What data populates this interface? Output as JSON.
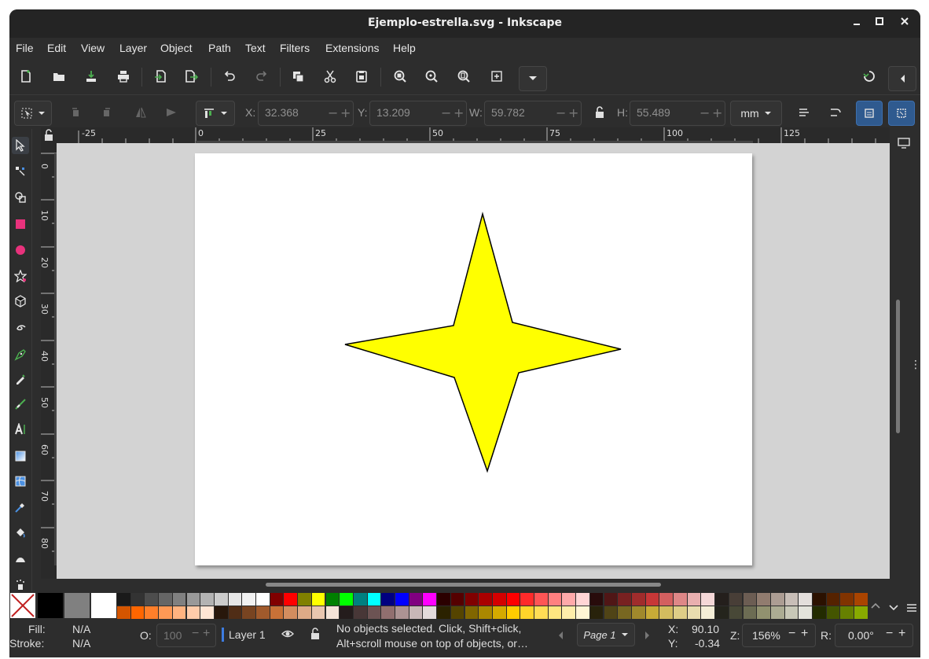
{
  "window": {
    "title": "Ejemplo-estrella.svg - Inkscape"
  },
  "menu": [
    "File",
    "Edit",
    "View",
    "Layer",
    "Object",
    "Path",
    "Text",
    "Filters",
    "Extensions",
    "Help"
  ],
  "toolbar": {
    "x_label": "X:",
    "x_value": "32.368",
    "y_label": "Y:",
    "y_value": "13.209",
    "w_label": "W:",
    "w_value": "59.782",
    "h_label": "H:",
    "h_value": "55.489",
    "unit": "mm"
  },
  "ruler": {
    "h_labels": [
      "-25",
      "0",
      "25",
      "50",
      "75",
      "100",
      "125"
    ],
    "v_labels": [
      "0",
      "10",
      "20",
      "30",
      "40",
      "50",
      "60",
      "70",
      "80"
    ]
  },
  "canvas": {
    "star_fill": "#ffff00",
    "star_stroke": "#000000",
    "page_color": "#ffffff",
    "desk_color": "#d3d3d3"
  },
  "palette": {
    "row1": [
      "#000000",
      "#1a1a1a",
      "#333333",
      "#4d4d4d",
      "#666666",
      "#808080",
      "#999999",
      "#b3b3b3",
      "#cccccc",
      "#e6e6e6",
      "#f2f2f2",
      "#ffffff",
      "#800000",
      "#ff0000",
      "#808000",
      "#ffff00",
      "#008000",
      "#00ff00",
      "#008080",
      "#00ffff",
      "#000080",
      "#0000ff",
      "#800080",
      "#ff00ff",
      "#2b0000",
      "#550000",
      "#800000",
      "#aa0000",
      "#d40000",
      "#ff0000",
      "#ff2a2a",
      "#ff5555",
      "#ff8080",
      "#ffaaaa",
      "#ffd5d5",
      "#280b0b",
      "#501616",
      "#782121",
      "#a02c2c",
      "#c83737",
      "#d35f5f",
      "#de8787",
      "#e9afaf",
      "#f4d7d7",
      "#241f1c",
      "#483e37",
      "#6c5d53",
      "#917c6f",
      "#ac9d93",
      "#c8beb7",
      "#e3dedb",
      "#2b1100",
      "#552200",
      "#803300",
      "#aa4400"
    ],
    "row2": [
      "#d45500",
      "#ff6600",
      "#ff7f2a",
      "#ff9955",
      "#ffb380",
      "#ffccaa",
      "#ffe6d5",
      "#28170b",
      "#502d16",
      "#784421",
      "#a05a2c",
      "#c87137",
      "#d38d5f",
      "#deaa87",
      "#e9c6af",
      "#f4e3d7",
      "#241c1c",
      "#483737",
      "#6c5353",
      "#916f6f",
      "#ac9393",
      "#c8b7b7",
      "#e3dbdb",
      "#2b2200",
      "#554400",
      "#806600",
      "#aa8800",
      "#d4aa00",
      "#ffcc00",
      "#ffd42a",
      "#ffdd55",
      "#ffe680",
      "#ffeeaa",
      "#fff6d5",
      "#28220b",
      "#504416",
      "#786721",
      "#a0892c",
      "#c8ab37",
      "#d3bc5f",
      "#decd87",
      "#e9ddaf",
      "#f4eed7",
      "#24241c",
      "#484837",
      "#6c6c53",
      "#91916f",
      "#acac93",
      "#c8c8b7",
      "#e3e3db",
      "#222b00",
      "#445500",
      "#668000",
      "#88aa00"
    ]
  },
  "status": {
    "fill_label": "Fill:",
    "fill_value": "N/A",
    "stroke_label": "Stroke:",
    "stroke_value": "N/A",
    "opacity_label": "O:",
    "opacity_value": "100",
    "layer": "Layer 1",
    "message_line1": "No objects selected. Click, Shift+click,",
    "message_line2": "Alt+scroll mouse on top of objects, or…",
    "page": "Page 1",
    "x_label": "X:",
    "x_value": "90.10",
    "y_label": "Y:",
    "y_value": "-0.34",
    "zoom_label": "Z:",
    "zoom_value": "156%",
    "rotation_label": "R:",
    "rotation_value": "0.00°"
  }
}
